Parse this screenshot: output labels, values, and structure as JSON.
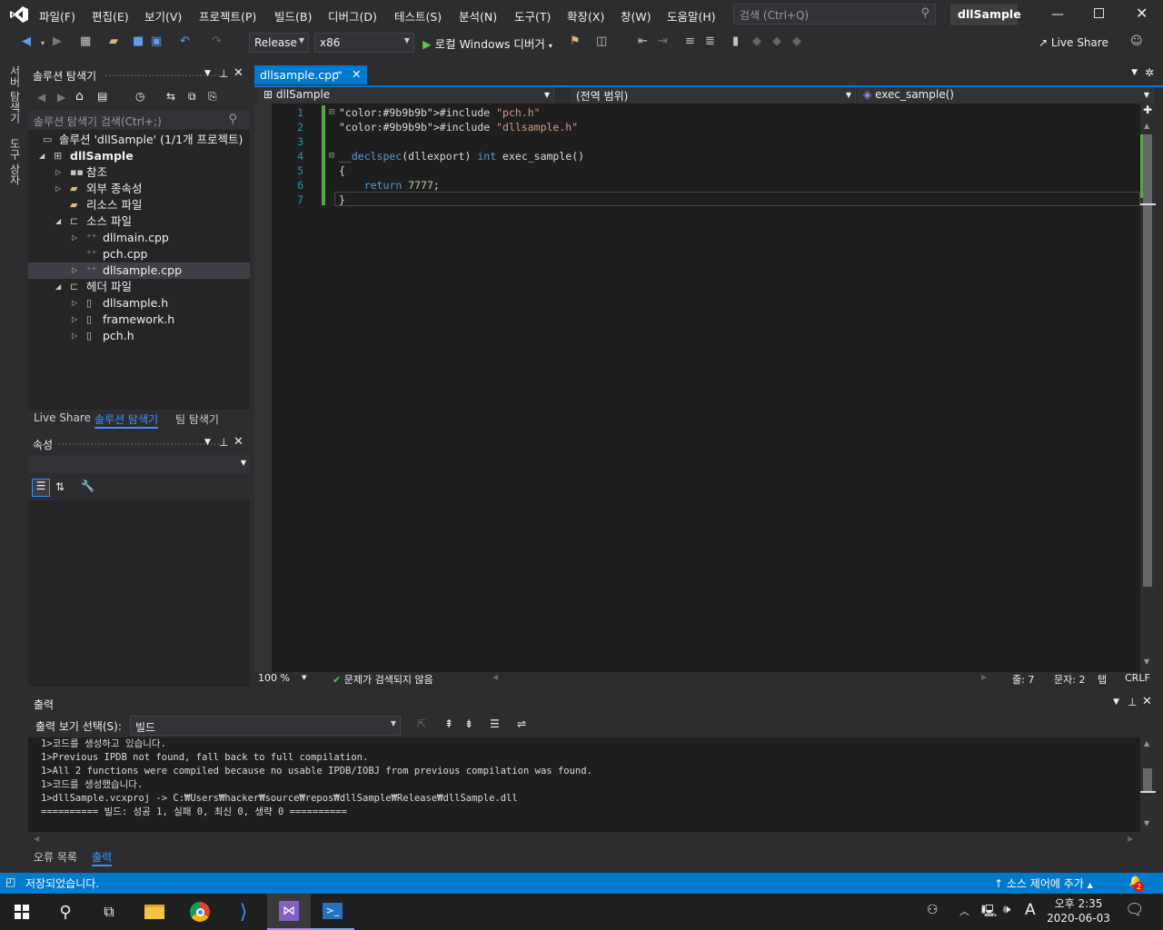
{
  "title_bar": {
    "menus": [
      "파일(F)",
      "편집(E)",
      "보기(V)",
      "프로젝트(P)",
      "빌드(B)",
      "디버그(D)",
      "테스트(S)",
      "분석(N)",
      "도구(T)",
      "확장(X)",
      "창(W)",
      "도움말(H)"
    ],
    "search_placeholder": "검색 (Ctrl+Q)",
    "solution_name": "dllSample",
    "window_controls": [
      "minimize-icon",
      "restore-icon",
      "close-icon"
    ]
  },
  "toolbar": {
    "configuration": "Release",
    "platform": "x86",
    "debug_target": "로컬 Windows 디버거",
    "live_share": "Live Share"
  },
  "left_strip": {
    "tabs": [
      "서버 탐색기",
      "도구 상자"
    ]
  },
  "solution_explorer": {
    "title": "솔루션 탐색기",
    "search_placeholder": "솔루션 탐색기 검색(Ctrl+;)",
    "tree": [
      {
        "label": "솔루션 'dllSample' (1/1개 프로젝트)",
        "level": 0,
        "icon": "solution-icon",
        "expander": ""
      },
      {
        "label": "dllSample",
        "level": 0,
        "icon": "project-icon",
        "expander": "◢",
        "bold": true
      },
      {
        "label": "참조",
        "level": 1,
        "icon": "references-icon",
        "expander": "▷"
      },
      {
        "label": "외부 종속성",
        "level": 1,
        "icon": "folder-icon",
        "expander": "▷"
      },
      {
        "label": "리소스 파일",
        "level": 1,
        "icon": "folder-icon",
        "expander": ""
      },
      {
        "label": "소스 파일",
        "level": 1,
        "icon": "folder-open-icon",
        "expander": "◢"
      },
      {
        "label": "dllmain.cpp",
        "level": 2,
        "icon": "cpp-file-icon",
        "expander": "▷"
      },
      {
        "label": "pch.cpp",
        "level": 2,
        "icon": "cpp-file-icon",
        "expander": ""
      },
      {
        "label": "dllsample.cpp",
        "level": 2,
        "icon": "cpp-file-icon",
        "expander": "▷",
        "selected": true
      },
      {
        "label": "헤더 파일",
        "level": 1,
        "icon": "folder-open-icon",
        "expander": "◢"
      },
      {
        "label": "dllsample.h",
        "level": 2,
        "icon": "header-file-icon",
        "expander": "▷"
      },
      {
        "label": "framework.h",
        "level": 2,
        "icon": "header-file-icon",
        "expander": "▷"
      },
      {
        "label": "pch.h",
        "level": 2,
        "icon": "header-file-icon",
        "expander": "▷"
      }
    ],
    "bottom_tabs": [
      "Live Share",
      "솔루션 탐색기",
      "팀 탐색기"
    ],
    "active_bottom_tab": "솔루션 탐색기"
  },
  "properties": {
    "title": "속성"
  },
  "editor": {
    "tab": "dllsample.cpp",
    "nav_project": "dllSample",
    "nav_scope": "(전역 범위)",
    "nav_member": "exec_sample()",
    "lines": [
      {
        "num": "1",
        "text": "#include \"pch.h\""
      },
      {
        "num": "2",
        "text": "#include \"dllsample.h\""
      },
      {
        "num": "3",
        "text": ""
      },
      {
        "num": "4",
        "text": "__declspec(dllexport) int exec_sample()"
      },
      {
        "num": "5",
        "text": "{"
      },
      {
        "num": "6",
        "text": "    return 7777;"
      },
      {
        "num": "7",
        "text": "}"
      }
    ],
    "zoom": "100 %",
    "issues": "문제가 검색되지 않음",
    "line": "줄: 7",
    "col": "문자: 2",
    "tab_mode": "탭",
    "eol": "CRLF",
    "colors": {
      "keyword": "#569cd6",
      "string": "#d69d85",
      "preprocessor": "#9b9b9b",
      "number": "#b5cea8",
      "line_number": "#2b91af",
      "accent": "#007acc"
    }
  },
  "output": {
    "title": "출력",
    "source_label": "출력 보기 선택(S):",
    "source_value": "빌드",
    "lines": [
      "1>코드를 생성하고 있습니다.",
      "1>Previous IPDB not found, fall back to full compilation.",
      "1>All 2 functions were compiled because no usable IPDB/IOBJ from previous compilation was found.",
      "1>코드를 생성했습니다.",
      "1>dllSample.vcxproj -> C:₩Users₩hacker₩source₩repos₩dllSample₩Release₩dllSample.dll",
      "========== 빌드: 성공 1, 실패 0, 최신 0, 생략 0 =========="
    ],
    "tabs": [
      "오류 목록",
      "출력"
    ],
    "active_tab": "출력"
  },
  "status_bar": {
    "message": "저장되었습니다.",
    "source_control": "소스 제어에 추가",
    "notifications": "2"
  },
  "taskbar": {
    "time": "오후 2:35",
    "date": "2020-06-03",
    "ime": "A"
  }
}
